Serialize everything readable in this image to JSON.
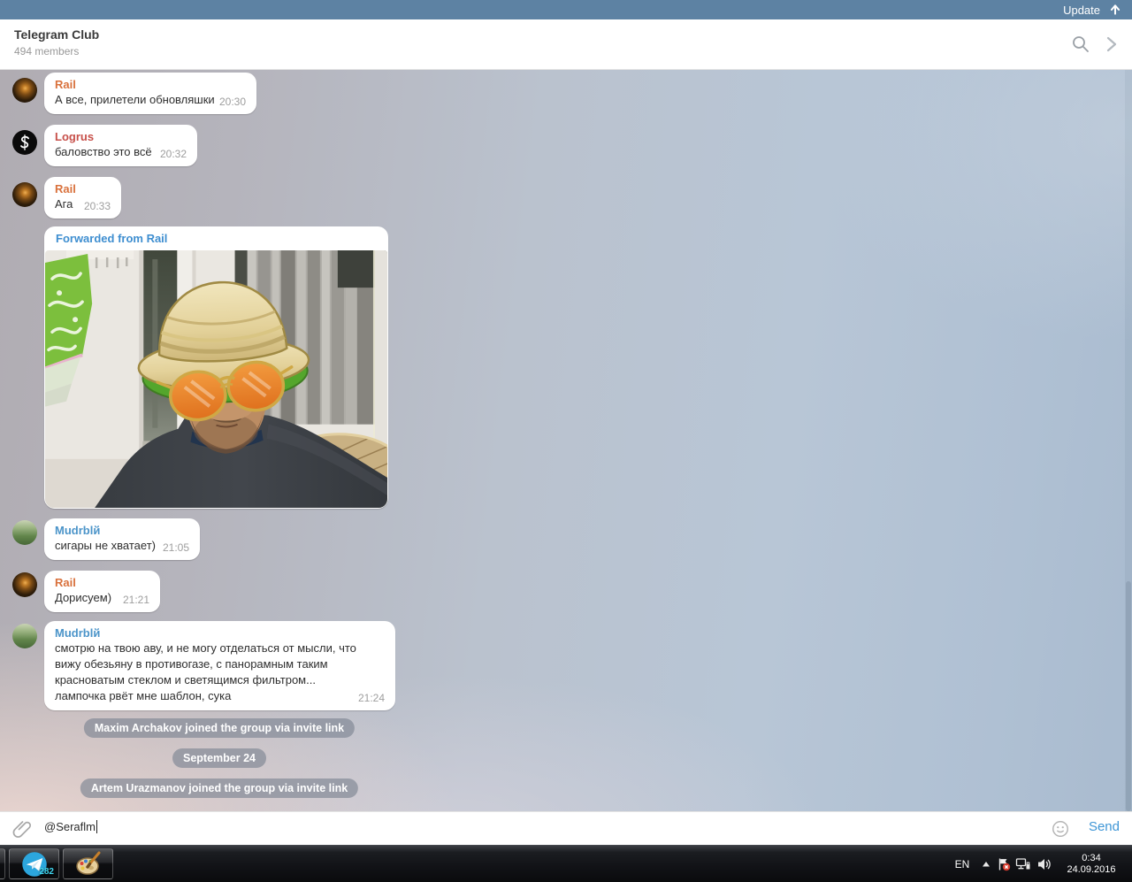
{
  "update_bar": {
    "label": "Update"
  },
  "header": {
    "title": "Telegram Club",
    "subtitle": "494 members"
  },
  "messages": [
    {
      "author": "Rail",
      "author_color": "#d9713c",
      "text": "А все, прилетели обновляшки",
      "time": "20:30"
    },
    {
      "author": "Logrus",
      "author_color": "#c7504a",
      "text": "баловство это всё",
      "time": "20:32"
    },
    {
      "author": "Rail",
      "author_color": "#d9713c",
      "text": "Ага",
      "time": "20:33"
    },
    {
      "forwarded_label": "Forwarded from Rail"
    },
    {
      "author": "Mudrblй",
      "author_color": "#4b94c9",
      "text": "сигары не хватает)",
      "time": "21:05"
    },
    {
      "author": "Rail",
      "author_color": "#d9713c",
      "text": "Дорисуем)",
      "time": "21:21"
    },
    {
      "author": "Mudrblй",
      "author_color": "#4b94c9",
      "text": "смотрю на твою аву, и не могу отделаться от мысли, что вижу обезьяну в противогазе, с панорамным таким красноватым стеклом и светящимся фильтром...\nлампочка рвёт мне шаблон, сука",
      "time": "21:24"
    }
  ],
  "service_messages": [
    "Maxim Archakov joined the group via invite link",
    "September 24",
    "Artem Urazmanov joined the group via invite link"
  ],
  "composer": {
    "value": "@Seraflm",
    "send_label": "Send"
  },
  "taskbar": {
    "telegram_badge": "282",
    "language": "EN",
    "time": "0:34",
    "date": "24.09.2016"
  },
  "colors": {
    "update_bar_bg": "#5d82a3",
    "forwarded_link": "#3e8ed0",
    "send_link": "#3f96d6",
    "name_rail": "#d9713c",
    "name_logrus": "#c7504a",
    "name_mudr": "#4b94c9",
    "service_pill": "rgba(126,134,147,0.66)"
  }
}
